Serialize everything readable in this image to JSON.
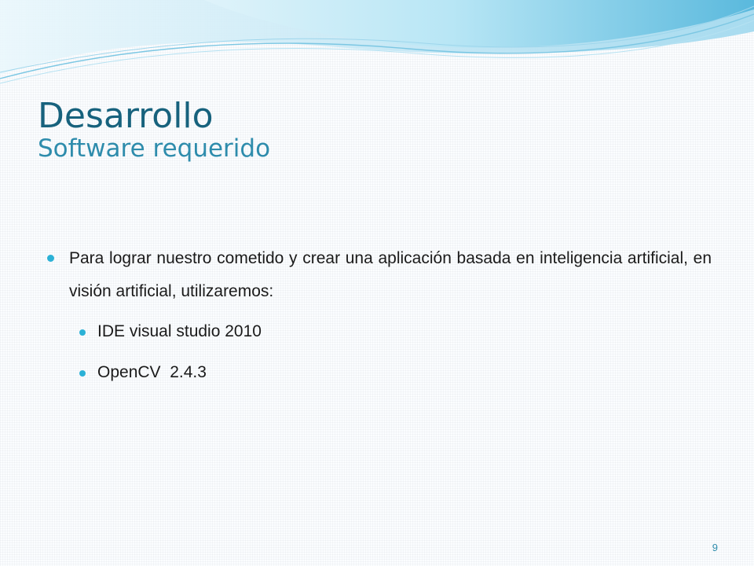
{
  "slide": {
    "title": "Desarrollo",
    "subtitle": "Software requerido",
    "bullets": [
      {
        "text": "Para lograr nuestro cometido y crear una aplicación basada en inteligencia artificial, en visión artificial, utilizaremos:",
        "subitems": [
          "IDE visual studio 2010",
          "OpenCV  2.4.3"
        ]
      }
    ],
    "page_number": "9"
  },
  "colors": {
    "title": "#17627d",
    "subtitle": "#2e8cac",
    "bullet": "#2bb1d6",
    "wave_light": "#a9e0f2",
    "wave_dark": "#5ab9dd"
  }
}
